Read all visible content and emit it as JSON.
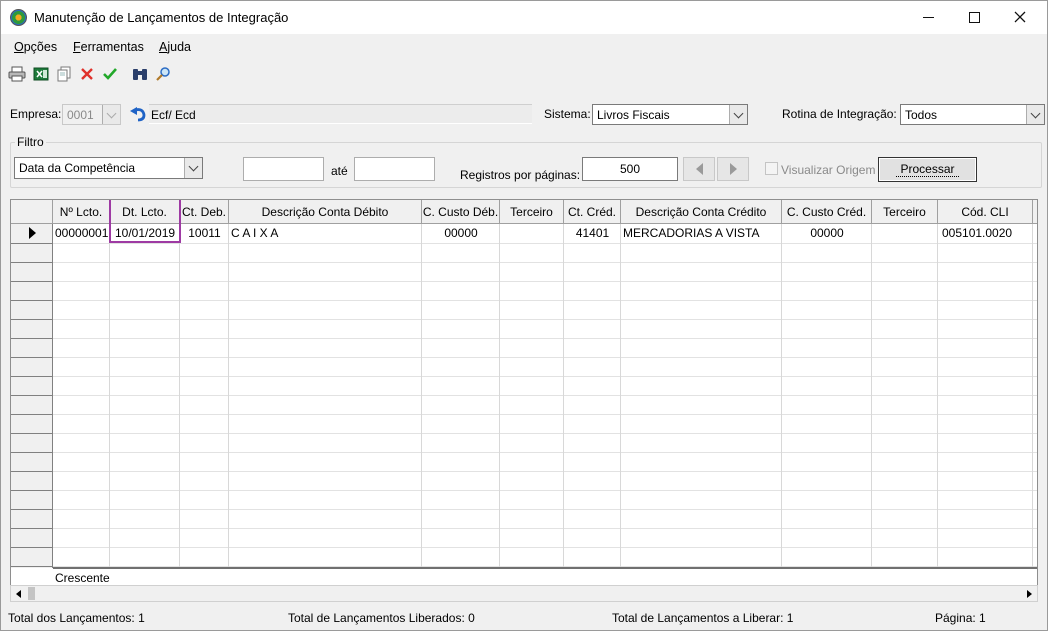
{
  "window": {
    "title": "Manutenção de Lançamentos de Integração"
  },
  "menu": [
    {
      "mnemonic": "O",
      "rest": "pções"
    },
    {
      "mnemonic": "F",
      "rest": "erramentas"
    },
    {
      "mnemonic": "A",
      "rest": "juda"
    }
  ],
  "toolbar_icons": [
    "print-icon",
    "excel-icon",
    "copy-icon",
    "delete-icon",
    "confirm-icon",
    "binoculars-icon",
    "search-icon"
  ],
  "empresa": {
    "label": "Empresa:",
    "value": "0001",
    "system_name": "Ecf/ Ecd"
  },
  "sistema": {
    "label": "Sistema:",
    "value": "Livros Fiscais"
  },
  "rotina": {
    "label": "Rotina de Integração:",
    "value": "Todos"
  },
  "filtro": {
    "legend": "Filtro",
    "type_value": "Data da Competência",
    "from_value": "",
    "ate_label": "até",
    "to_value": "",
    "registros_label": "Registros por páginas:",
    "registros_value": "500",
    "visualizar_label": "Visualizar Origem",
    "process_label": "Processar"
  },
  "grid": {
    "columns": [
      "Nº Lcto.",
      "Dt. Lcto.",
      "Ct. Deb.",
      "Descrição Conta Débito",
      "C. Custo Déb.",
      "Terceiro",
      "Ct. Créd.",
      "Descrição Conta Crédito",
      "C. Custo Créd.",
      "Terceiro",
      "Cód. CLI"
    ],
    "rows": [
      [
        "00000001",
        "10/01/2019",
        "10011",
        "C A I X A",
        "00000",
        "",
        "41401",
        "MERCADORIAS A VISTA",
        "00000",
        "",
        "005101.0020"
      ]
    ],
    "footer_label": "Crescente"
  },
  "status": {
    "total_lancamentos": "Total dos Lançamentos: 1",
    "total_liberados": "Total de Lançamentos Liberados: 0",
    "total_a_liberar": "Total de Lançamentos a Liberar: 1",
    "pagina": "Página: 1"
  },
  "colors": {
    "highlight": "#9e3aa3",
    "delete": "#e0312b",
    "confirm": "#22a82a"
  }
}
